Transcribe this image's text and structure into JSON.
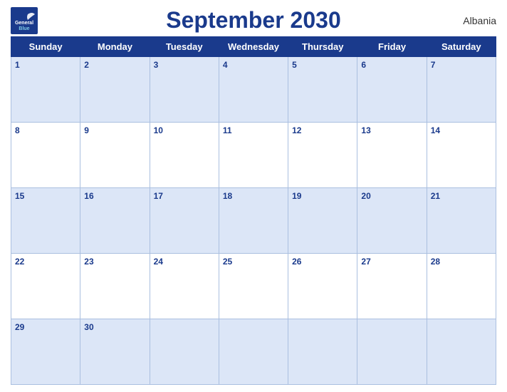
{
  "header": {
    "title": "September 2030",
    "country": "Albania",
    "logo": {
      "general": "General",
      "blue": "Blue"
    }
  },
  "days_of_week": [
    "Sunday",
    "Monday",
    "Tuesday",
    "Wednesday",
    "Thursday",
    "Friday",
    "Saturday"
  ],
  "weeks": [
    [
      {
        "day": 1,
        "empty": false
      },
      {
        "day": 2,
        "empty": false
      },
      {
        "day": 3,
        "empty": false
      },
      {
        "day": 4,
        "empty": false
      },
      {
        "day": 5,
        "empty": false
      },
      {
        "day": 6,
        "empty": false
      },
      {
        "day": 7,
        "empty": false
      }
    ],
    [
      {
        "day": 8,
        "empty": false
      },
      {
        "day": 9,
        "empty": false
      },
      {
        "day": 10,
        "empty": false
      },
      {
        "day": 11,
        "empty": false
      },
      {
        "day": 12,
        "empty": false
      },
      {
        "day": 13,
        "empty": false
      },
      {
        "day": 14,
        "empty": false
      }
    ],
    [
      {
        "day": 15,
        "empty": false
      },
      {
        "day": 16,
        "empty": false
      },
      {
        "day": 17,
        "empty": false
      },
      {
        "day": 18,
        "empty": false
      },
      {
        "day": 19,
        "empty": false
      },
      {
        "day": 20,
        "empty": false
      },
      {
        "day": 21,
        "empty": false
      }
    ],
    [
      {
        "day": 22,
        "empty": false
      },
      {
        "day": 23,
        "empty": false
      },
      {
        "day": 24,
        "empty": false
      },
      {
        "day": 25,
        "empty": false
      },
      {
        "day": 26,
        "empty": false
      },
      {
        "day": 27,
        "empty": false
      },
      {
        "day": 28,
        "empty": false
      }
    ],
    [
      {
        "day": 29,
        "empty": false
      },
      {
        "day": 30,
        "empty": false
      },
      {
        "day": null,
        "empty": true
      },
      {
        "day": null,
        "empty": true
      },
      {
        "day": null,
        "empty": true
      },
      {
        "day": null,
        "empty": true
      },
      {
        "day": null,
        "empty": true
      }
    ]
  ],
  "colors": {
    "header_bg": "#1a3a8c",
    "row_odd": "#dce6f7",
    "row_even": "#ffffff",
    "border": "#aabfe0"
  }
}
